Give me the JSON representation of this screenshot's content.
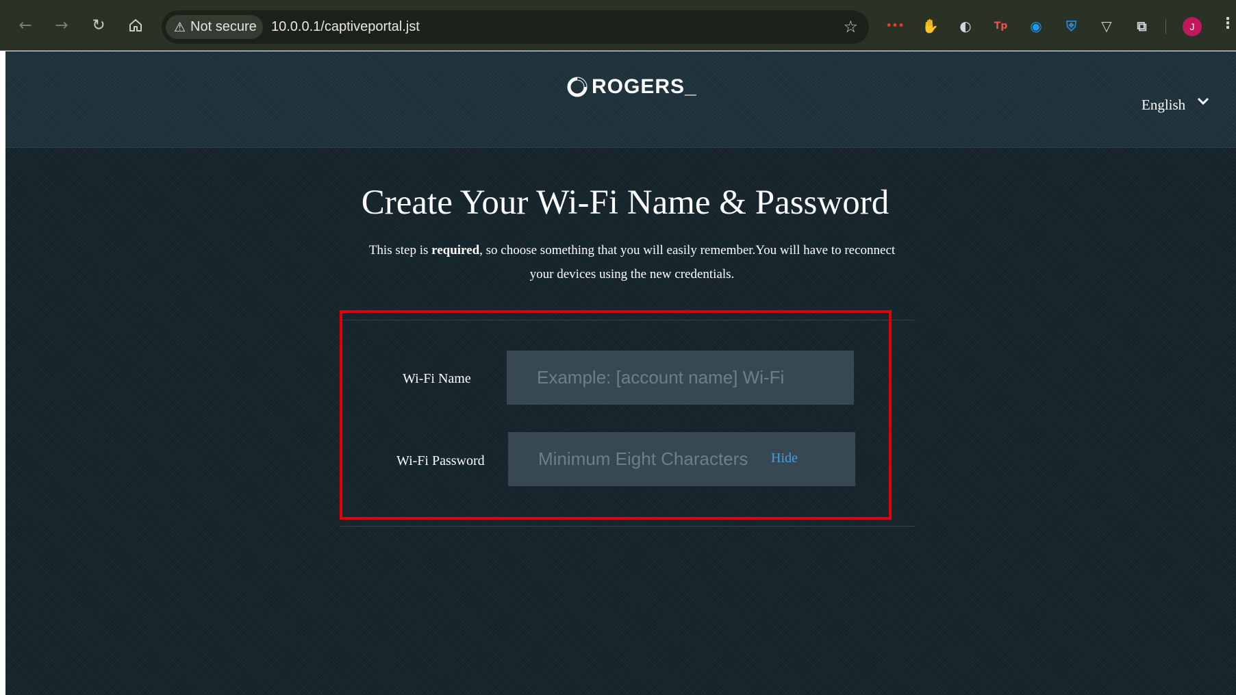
{
  "browser": {
    "security_label": "Not secure",
    "url": "10.0.0.1/captiveportal.jst",
    "avatar_letter": "J",
    "extensions": [
      {
        "name": "ext-red-dots",
        "glyph": "•••",
        "color": "#e53935"
      },
      {
        "name": "ext-hand-stop",
        "glyph": "✋",
        "color": "#e53935"
      },
      {
        "name": "ext-globe-user",
        "glyph": "◐",
        "color": "#cfd8dc"
      },
      {
        "name": "ext-tp",
        "glyph": "Tp",
        "color": "#ef5350"
      },
      {
        "name": "ext-swirl",
        "glyph": "◉",
        "color": "#2196f3"
      },
      {
        "name": "ext-shield",
        "glyph": "⛨",
        "color": "#1e88e5"
      },
      {
        "name": "ext-triangle",
        "glyph": "▽",
        "color": "#cfd8dc"
      },
      {
        "name": "ext-puzzle",
        "glyph": "⧉",
        "color": "#cfd8dc"
      }
    ]
  },
  "header": {
    "logo_text": "ROGERS",
    "language": "English"
  },
  "main": {
    "title": "Create Your Wi-Fi Name & Password",
    "intro_prefix": "This step is ",
    "intro_bold": "required",
    "intro_suffix": ", so choose something that you will easily remember.You will have to reconnect your devices using the new credentials."
  },
  "form": {
    "wifi_name_label": "Wi-Fi Name",
    "wifi_name_placeholder": "Example: [account name] Wi-Fi",
    "wifi_name_value": "",
    "wifi_password_label": "Wi-Fi Password",
    "wifi_password_placeholder": "Minimum Eight Characters",
    "wifi_password_value": "",
    "hide_label": "Hide"
  },
  "colors": {
    "highlight_box": "#e0000a",
    "page_bg": "#17262d",
    "link": "#3fa0e6"
  }
}
